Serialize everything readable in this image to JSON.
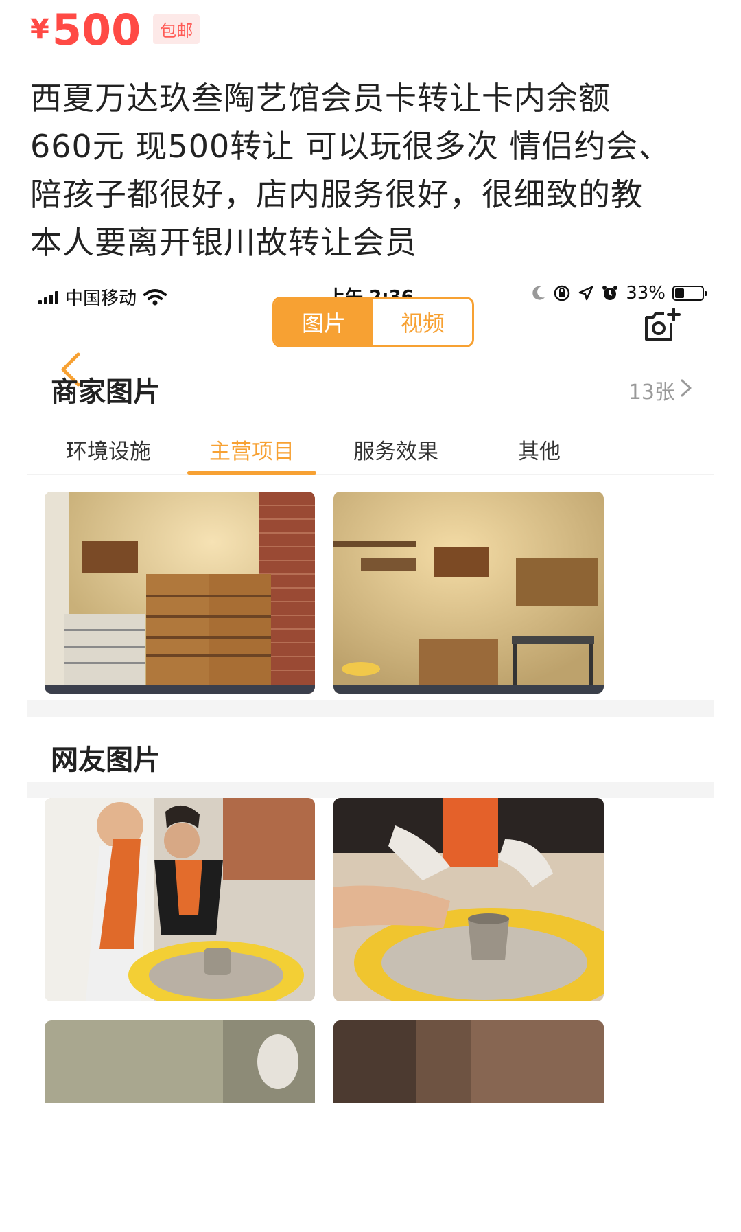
{
  "listing": {
    "currency": "¥",
    "price": "500",
    "shipping_badge": "包邮",
    "description_lines": [
      "西夏万达玖叁陶艺馆会员卡转让卡内余额",
      "660元 现500转让 可以玩很多次 情侣约会、",
      "陪孩子都很好，店内服务很好，很细致的教",
      "本人要离开银川故转让会员"
    ]
  },
  "status_bar": {
    "carrier": "中国移动",
    "time": "上午 2:36",
    "battery": "33%",
    "battery_level": 0.33
  },
  "nav": {
    "segments": [
      "图片",
      "视频"
    ],
    "active_segment": "图片"
  },
  "merchant": {
    "title": "商家图片",
    "count": "13张",
    "tabs": [
      "环境设施",
      "主营项目",
      "服务效果",
      "其他"
    ],
    "active_tab": "主营项目"
  },
  "user_photos": {
    "title": "网友图片"
  },
  "colors": {
    "price_red": "#ff4a45",
    "accent_orange": "#f7a133"
  },
  "icons": [
    "back-chevron-icon",
    "camera-add-icon",
    "chevron-right-icon",
    "wifi-icon",
    "moon-icon",
    "location-icon",
    "alarm-icon",
    "lock-rotation-icon"
  ]
}
